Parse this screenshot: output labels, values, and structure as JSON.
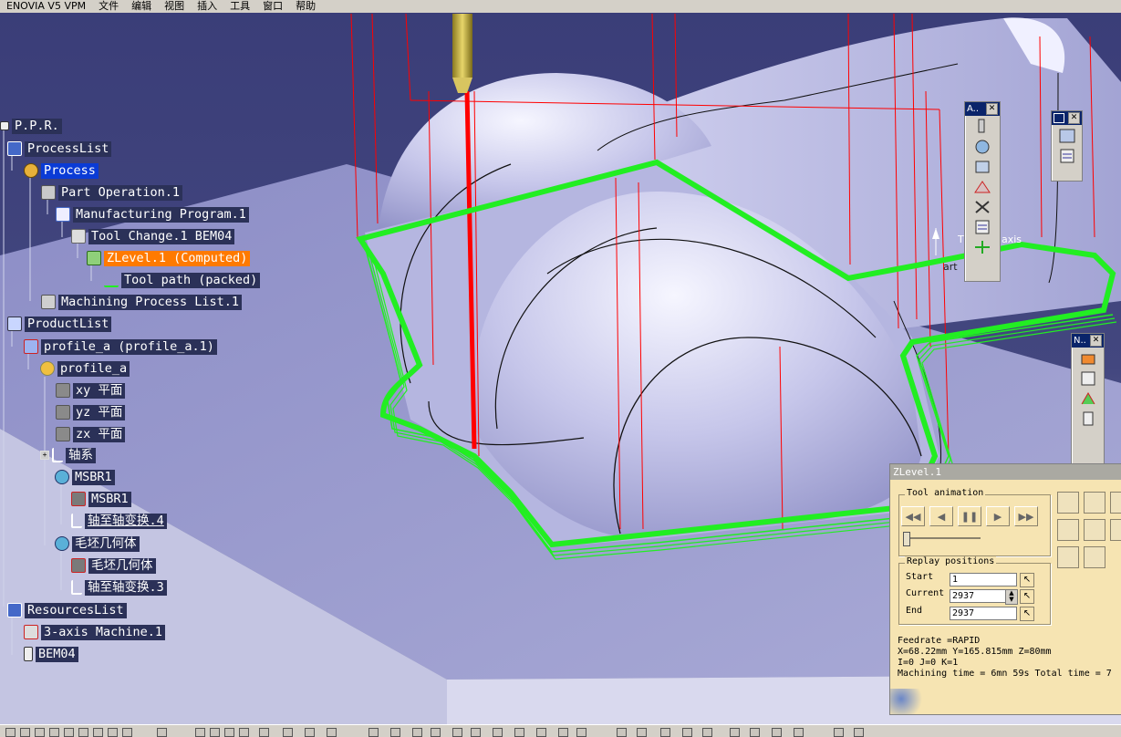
{
  "menu": [
    "ENOVIA V5 VPM",
    "文件",
    "编辑",
    "视图",
    "插入",
    "工具",
    "窗口",
    "帮助"
  ],
  "tree": [
    {
      "id": "ppr",
      "label": "P.P.R.",
      "icon": "ppr-icon"
    },
    {
      "id": "processlist",
      "label": "ProcessList",
      "icon": "process-list-icon"
    },
    {
      "id": "process",
      "label": "Process",
      "icon": "process-icon",
      "state": "selected"
    },
    {
      "id": "part-operation",
      "label": "Part Operation.1",
      "icon": "part-operation-icon"
    },
    {
      "id": "manufacturing-program",
      "label": "Manufacturing Program.1",
      "icon": "manufacturing-program-icon"
    },
    {
      "id": "tool-change",
      "label": "Tool Change.1  BEM04",
      "icon": "tool-change-icon"
    },
    {
      "id": "zlevel",
      "label": "ZLevel.1 (Computed)",
      "icon": "zlevel-icon",
      "state": "active"
    },
    {
      "id": "tool-path",
      "label": "Tool path (packed)",
      "icon": "tool-path-icon"
    },
    {
      "id": "machining-process-list",
      "label": "Machining Process List.1",
      "icon": "machining-process-list-icon"
    },
    {
      "id": "productlist",
      "label": "ProductList",
      "icon": "product-list-icon"
    },
    {
      "id": "profile-a-inst",
      "label": "profile_a (profile_a.1)",
      "icon": "product-icon"
    },
    {
      "id": "profile-a",
      "label": "profile_a",
      "icon": "part-icon"
    },
    {
      "id": "xy-plane",
      "label": "xy 平面",
      "icon": "plane-icon"
    },
    {
      "id": "yz-plane",
      "label": "yz 平面",
      "icon": "plane-icon"
    },
    {
      "id": "zx-plane",
      "label": "zx 平面",
      "icon": "plane-icon"
    },
    {
      "id": "axis-system",
      "label": "轴系",
      "icon": "axis-system-icon"
    },
    {
      "id": "msbr1-body",
      "label": "MSBR1",
      "icon": "body-icon"
    },
    {
      "id": "msbr1",
      "label": "MSBR1",
      "icon": "solid-icon"
    },
    {
      "id": "axis-transform-4",
      "label": "轴至轴变换.4",
      "icon": "axis-transform-icon"
    },
    {
      "id": "stock-geometry",
      "label": "毛坯几何体",
      "icon": "body-icon"
    },
    {
      "id": "stock-geometry-solid",
      "label": "毛坯几何体",
      "icon": "solid-icon"
    },
    {
      "id": "axis-transform-3",
      "label": "轴至轴变换.3",
      "icon": "axis-transform-icon"
    },
    {
      "id": "resourceslist",
      "label": "ResourcesList",
      "icon": "resources-list-icon"
    },
    {
      "id": "machine",
      "label": "3-axis Machine.1",
      "icon": "machine-icon"
    },
    {
      "id": "tool",
      "label": "BEM04",
      "icon": "tool-icon"
    }
  ],
  "viewport": {
    "axis_labels": [
      "T",
      "axis",
      "art"
    ]
  },
  "toolbars": {
    "a_title": "A..",
    "n_title": "N.."
  },
  "dialog": {
    "title": "ZLevel.1",
    "tool_animation_label": "Tool animation",
    "replay_label": "Replay positions",
    "start_label": "Start",
    "start_value": "1",
    "current_label": "Current",
    "current_value": "2937",
    "end_label": "End",
    "end_value": "2937",
    "feedrate": "Feedrate =RAPID",
    "position": "X=68.22mm Y=165.815mm Z=80mm",
    "ijk": "I=0 J=0 K=1",
    "machining_time": "Machining time = 6mn 59s    Total time = 7"
  },
  "colors": {
    "toolpath_green": "#22ee22",
    "rapid_red": "#ff0000",
    "active_node": "#ff7a00",
    "selected_node": "#0a3bd6",
    "dialog_bg": "#f6e4b2"
  }
}
